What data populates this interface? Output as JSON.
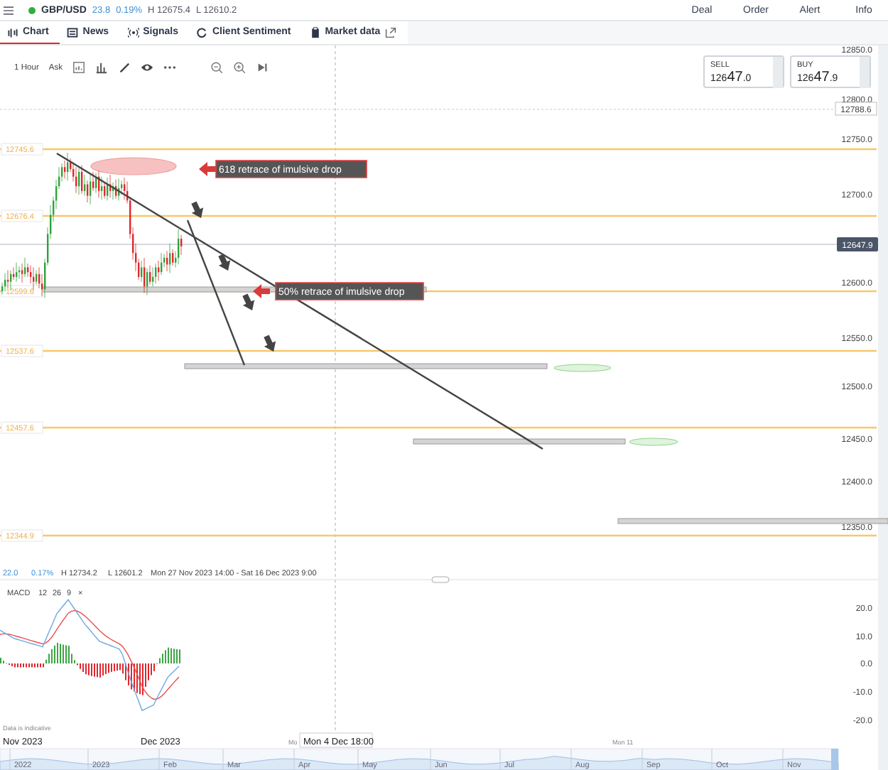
{
  "instrument": {
    "symbol": "GBP/USD",
    "market_open": true,
    "change": "23.8",
    "change_pct": "0.19%",
    "high": "H 12675.4",
    "low": "L 12610.2"
  },
  "top_actions": [
    "Deal",
    "Order",
    "Alert",
    "Info"
  ],
  "tabs": [
    {
      "label": "Chart",
      "selected": true
    },
    {
      "label": "News",
      "selected": false
    },
    {
      "label": "Signals",
      "selected": false
    },
    {
      "label": "Client Sentiment",
      "selected": false
    },
    {
      "label": "Market data",
      "selected": false
    }
  ],
  "toolbar": {
    "timeframe": "1 Hour",
    "price_type": "Ask"
  },
  "quotes": [
    {
      "label": "SELL",
      "price_prefix": "126",
      "price_main": "47",
      "price_suffix": ".0"
    },
    {
      "label": "BUY",
      "price_prefix": "126",
      "price_main": "47",
      "price_suffix": ".9"
    }
  ],
  "price_axis": [
    "12850.0",
    "12800.0",
    "12750.0",
    "12700.0",
    "12600.0",
    "12550.0",
    "12500.0",
    "12450.0",
    "12400.0",
    "12350.0"
  ],
  "marker_price": "12788.6",
  "current_price": "12647.9",
  "levels": [
    "12745.6",
    "12676.4",
    "12599.6",
    "12537.6",
    "12457.6",
    "12344.9"
  ],
  "annotations": [
    {
      "text": "618 retrace of imulsive drop"
    },
    {
      "text": "50% retrace of imulsive drop"
    }
  ],
  "stats": {
    "change": "22.0",
    "change_pct": "0.17%",
    "high": "H 12734.2",
    "low": "L 12601.2",
    "range": "Mon 27 Nov 2023 14:00 - Sat 16 Dec 2023 9:00"
  },
  "macd": {
    "label": "MACD",
    "params": [
      "12",
      "26",
      "9"
    ],
    "close": "×",
    "axis": [
      "20.0",
      "10.0",
      "0.0",
      "-10.0",
      "-20.0"
    ]
  },
  "disclaimer": "Data is indicative",
  "time_axis": [
    "Nov 2023",
    "Dec 2023",
    "Mo",
    "Mon 11"
  ],
  "crosshair_time": "Mon 4 Dec 18:00",
  "navigator": [
    "2022",
    "2023",
    "Feb",
    "Mar",
    "Apr",
    "May",
    "Jun",
    "Jul",
    "Aug",
    "Sep",
    "Oct",
    "Nov"
  ]
}
